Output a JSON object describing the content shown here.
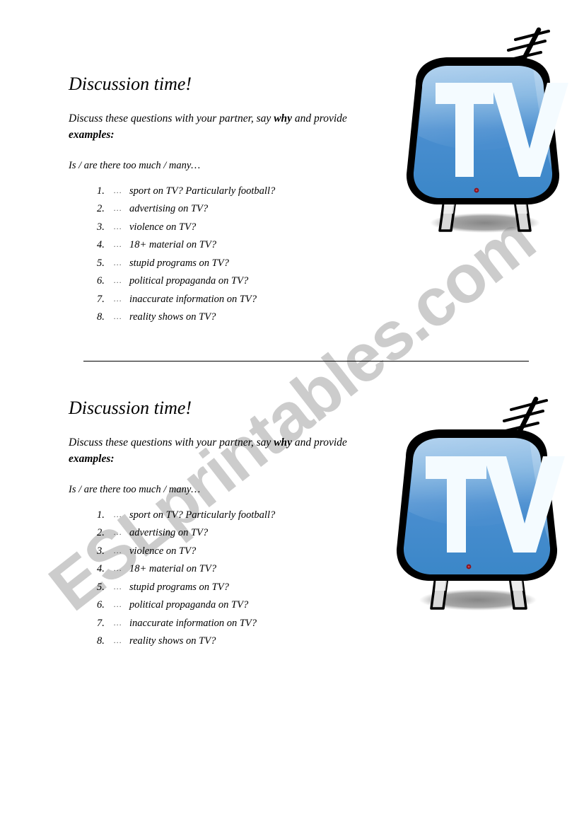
{
  "document": {
    "title": "Discussion time!",
    "watermark": "ESLprintables.com",
    "watermark_color": "#cccccc"
  },
  "sections": [
    {
      "heading": "Discussion time!",
      "instructions_part1": "Discuss these questions with your partner, say ",
      "instructions_bold1": "why",
      "instructions_part2": " and provide ",
      "instructions_bold2": "examples:",
      "prompt": "Is / are there too much / many…",
      "ellipsis": "…",
      "items": [
        "sport on TV? Particularly football?",
        "advertising on TV?",
        "violence on TV?",
        "18+ material on TV?",
        "stupid programs on TV?",
        "political propaganda on TV?",
        "inaccurate information on TV?",
        "reality shows on TV?"
      ],
      "illustration": {
        "name": "tv-set",
        "screen_label": "TV",
        "body_color": "#000000",
        "screen_color_top": "#7bb2e0",
        "screen_color_bottom": "#3b87c8",
        "leg_color": "#d8d8d8",
        "led_color": "#8a1520",
        "shadow_color": "#808080"
      }
    },
    {
      "heading": "Discussion time!",
      "instructions_part1": "Discuss these questions with your partner, say ",
      "instructions_bold1": "why",
      "instructions_part2": " and provide ",
      "instructions_bold2": "examples:",
      "prompt": "Is / are there too much / many…",
      "ellipsis": "…",
      "items": [
        "sport on TV? Particularly football?",
        "advertising on TV?",
        "violence on TV?",
        "18+ material on TV?",
        "stupid programs on TV?",
        "political propaganda on TV?",
        "inaccurate information on TV?",
        "reality shows on TV?"
      ],
      "illustration": {
        "name": "tv-set",
        "screen_label": "TV",
        "body_color": "#000000",
        "screen_color_top": "#7bb2e0",
        "screen_color_bottom": "#3b87c8",
        "leg_color": "#d8d8d8",
        "led_color": "#8a1520",
        "shadow_color": "#808080"
      }
    }
  ]
}
